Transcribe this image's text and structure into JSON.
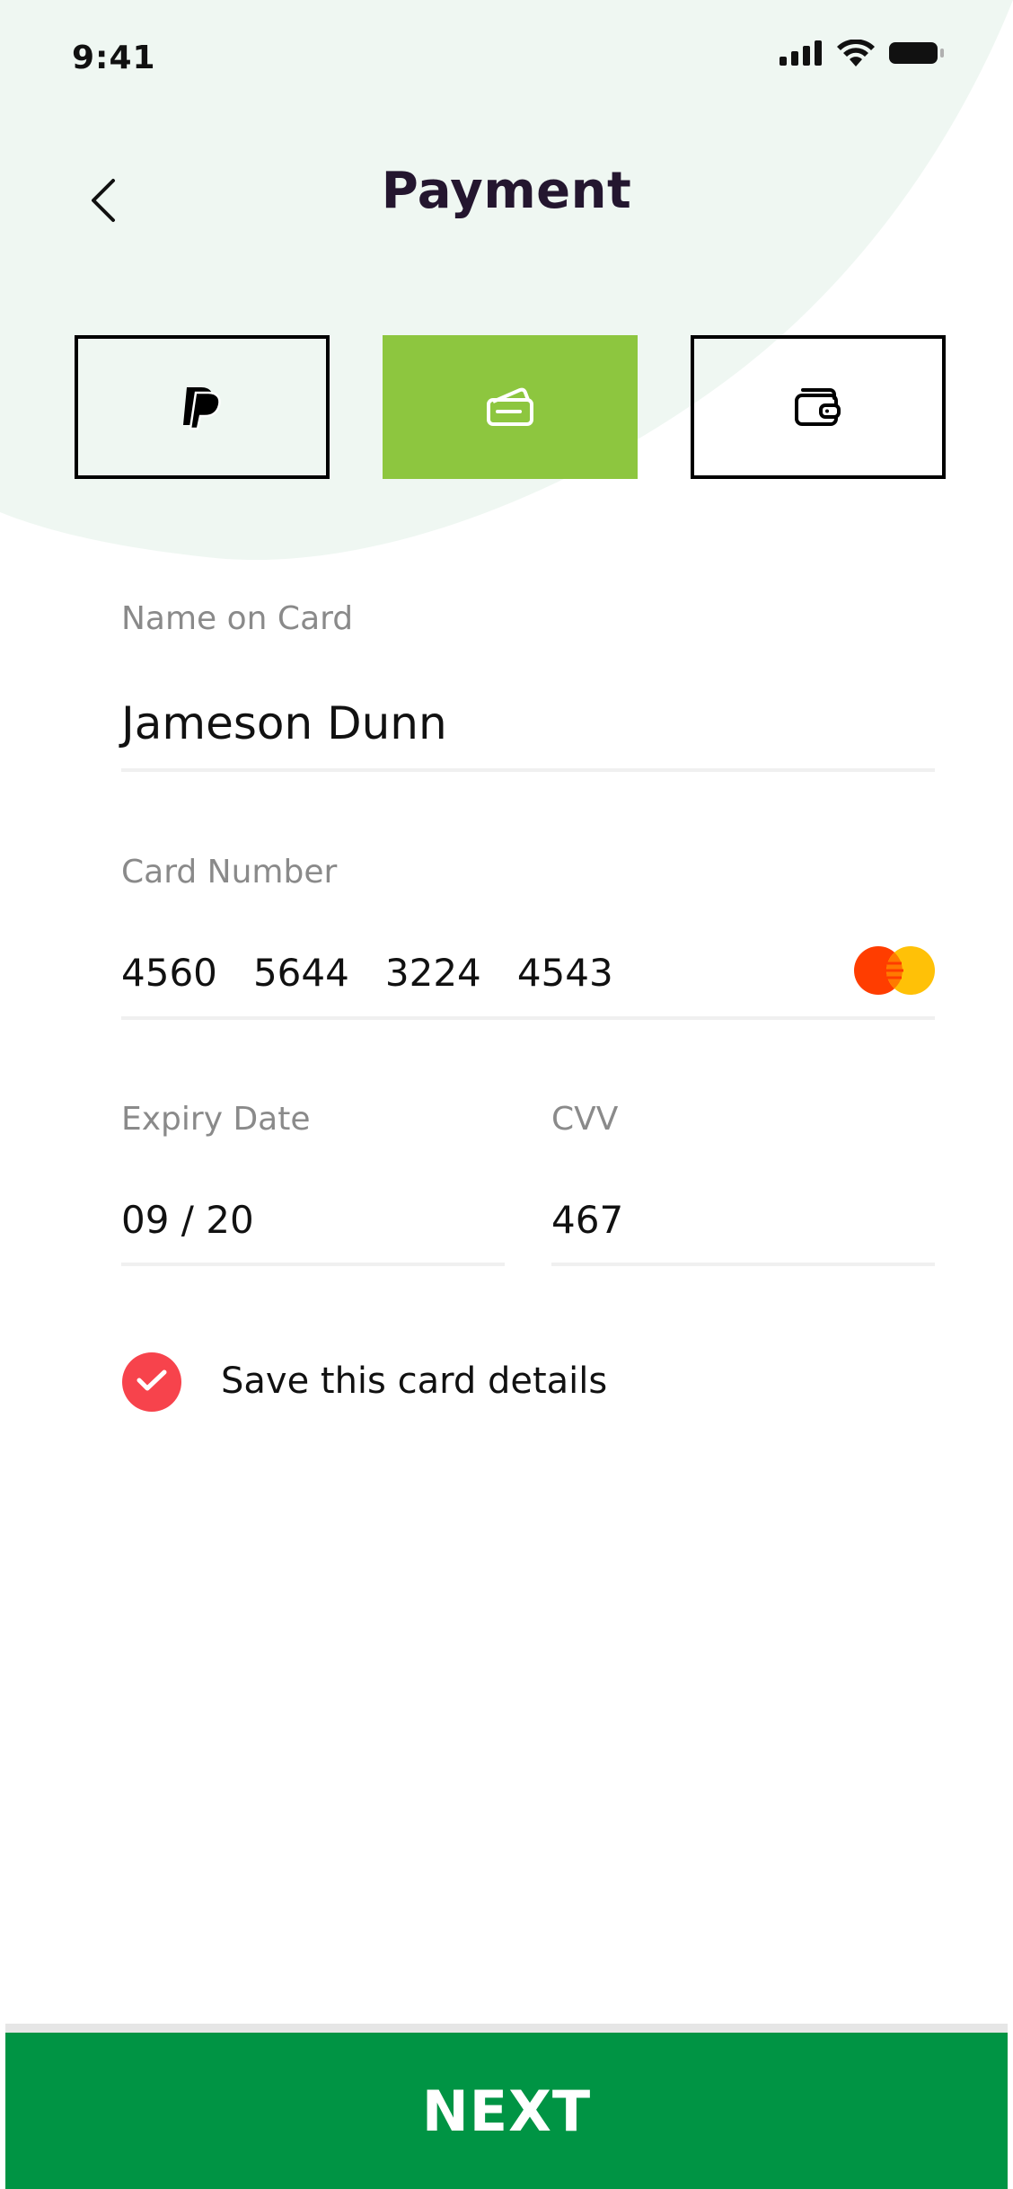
{
  "status_bar": {
    "time": "9:41",
    "icons": [
      "cellular-signal-icon",
      "wifi-icon",
      "battery-icon"
    ]
  },
  "header": {
    "back_icon": "chevron-left-icon",
    "title": "Payment"
  },
  "payment_methods": [
    {
      "id": "paypal",
      "icon": "paypal-icon",
      "selected": false
    },
    {
      "id": "card",
      "icon": "credit-card-icon",
      "selected": true
    },
    {
      "id": "wallet",
      "icon": "wallet-icon",
      "selected": false
    }
  ],
  "form": {
    "name": {
      "label": "Name on Card",
      "value": "Jameson Dunn"
    },
    "card_number": {
      "label": "Card Number",
      "value": "4560   5644   3224   4543",
      "brand_icon": "mastercard-icon"
    },
    "expiry": {
      "label": "Expiry Date",
      "value": "09 / 20"
    },
    "cvv": {
      "label": "CVV",
      "value": "467"
    },
    "save_card": {
      "label": "Save this card details",
      "checked": true
    }
  },
  "footer": {
    "next_label": "NEXT"
  },
  "colors": {
    "background_blob": "#eff7f2",
    "active_tab": "#8dc63f",
    "title": "#24162f",
    "checkbox": "#f7434c",
    "next_button": "#009444",
    "label": "#8a8a8a",
    "mastercard_red": "#ff3d00",
    "mastercard_yellow": "#ffc107"
  }
}
